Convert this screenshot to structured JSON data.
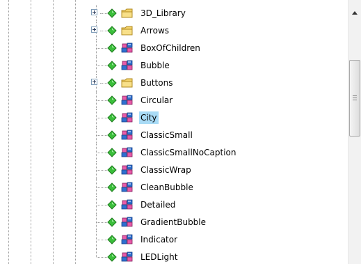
{
  "tree": {
    "items": [
      {
        "label": "3D_Library",
        "type": "folder",
        "expandable": true
      },
      {
        "label": "Arrows",
        "type": "folder",
        "expandable": true
      },
      {
        "label": "BoxOfChildren",
        "type": "component",
        "expandable": false
      },
      {
        "label": "Bubble",
        "type": "component",
        "expandable": false
      },
      {
        "label": "Buttons",
        "type": "folder",
        "expandable": true
      },
      {
        "label": "Circular",
        "type": "component",
        "expandable": false
      },
      {
        "label": "City",
        "type": "component",
        "expandable": false,
        "selected": true
      },
      {
        "label": "ClassicSmall",
        "type": "component",
        "expandable": false
      },
      {
        "label": "ClassicSmallNoCaption",
        "type": "component",
        "expandable": false
      },
      {
        "label": "ClassicWrap",
        "type": "component",
        "expandable": false
      },
      {
        "label": "CleanBubble",
        "type": "component",
        "expandable": false
      },
      {
        "label": "Detailed",
        "type": "component",
        "expandable": false
      },
      {
        "label": "GradientBubble",
        "type": "component",
        "expandable": false
      },
      {
        "label": "Indicator",
        "type": "component",
        "expandable": false
      },
      {
        "label": "LEDLight",
        "type": "component",
        "expandable": false
      }
    ],
    "icons": {
      "expander": "plus-box-icon",
      "node": "green-diamond-icon",
      "folder": "folder-icon",
      "component": "component-package-icon"
    },
    "colors": {
      "selection": "#a9dbf6",
      "diamond": "#3bbf3b",
      "folder": "#f3d36b",
      "component_blue": "#2f6fd0",
      "component_pink": "#e85aa8"
    }
  },
  "scrollbar": {
    "icons": {
      "up": "arrow-up-icon",
      "thumb_grip": "grip-icon"
    }
  }
}
